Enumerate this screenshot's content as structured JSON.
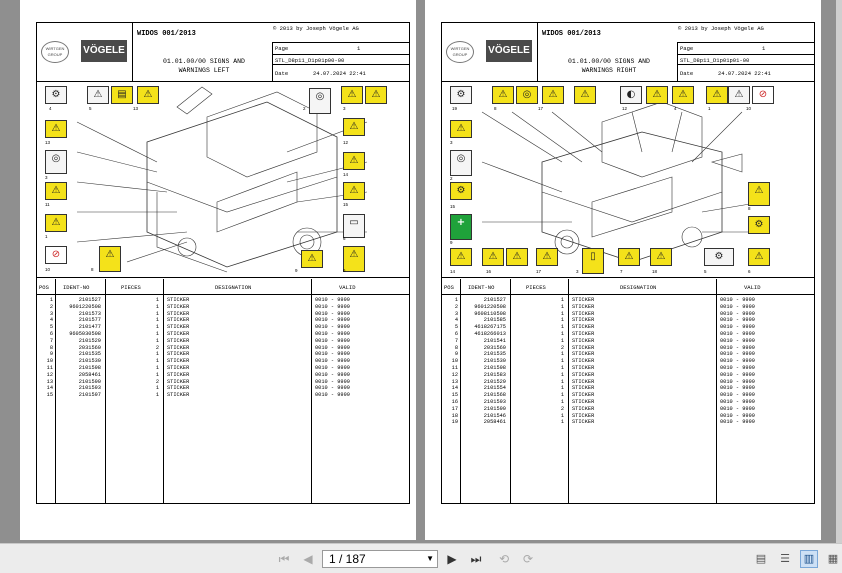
{
  "pages": [
    {
      "doc_title": "WIDOS 001/2013",
      "copyright": "© 2013 by Joseph Vögele AG",
      "logo_left": "WIRTGEN GROUP",
      "logo_right": "VÖGELE",
      "section_line1": "01.01.00/00 SIGNS AND",
      "section_line2": "WARNINGS LEFT",
      "page_label": "Page",
      "page_number": "1",
      "doc_code": "STL_D8p11_D1p01p00-00",
      "date_label": "Date",
      "date_value": "24.07.2024  22:41",
      "sign_numbers": [
        "4",
        "5",
        "13",
        "2",
        "3",
        "13",
        "12",
        "3",
        "14",
        "11",
        "15",
        "1",
        "6",
        "10",
        "8",
        "9",
        "6"
      ],
      "table": {
        "headers": [
          "POS",
          "IDENT-NO",
          "PIECES",
          "DESIGNATION",
          "VALID"
        ],
        "rows": [
          [
            "1",
            "2101527",
            "1",
            "STICKER",
            "0010 - 9999"
          ],
          [
            "2",
            "9601220508",
            "1",
            "STICKER",
            "0010 - 9999"
          ],
          [
            "3",
            "2101573",
            "1",
            "STICKER",
            "0010 - 9999"
          ],
          [
            "4",
            "2101577",
            "1",
            "STICKER",
            "0010 - 9999"
          ],
          [
            "5",
            "2101477",
            "1",
            "STICKER",
            "0010 - 9999"
          ],
          [
            "6",
            "9605030508",
            "1",
            "STICKER",
            "0010 - 9999"
          ],
          [
            "7",
            "2101529",
            "1",
            "STICKER",
            "0010 - 9999"
          ],
          [
            "8",
            "2031560",
            "2",
            "STICKER",
            "0010 - 9999"
          ],
          [
            "9",
            "2101535",
            "1",
            "STICKER",
            "0010 - 9999"
          ],
          [
            "10",
            "2101530",
            "1",
            "STICKER",
            "0010 - 9999"
          ],
          [
            "11",
            "2101598",
            "1",
            "STICKER",
            "0010 - 9999"
          ],
          [
            "12",
            "2058461",
            "1",
            "STICKER",
            "0010 - 9999"
          ],
          [
            "13",
            "2101590",
            "2",
            "STICKER",
            "0010 - 9999"
          ],
          [
            "14",
            "2101593",
            "1",
            "STICKER",
            "0010 - 9999"
          ],
          [
            "15",
            "2101597",
            "1",
            "STICKER",
            "0010 - 9999"
          ]
        ]
      }
    },
    {
      "doc_title": "WIDOS 001/2013",
      "copyright": "© 2013 by Joseph Vögele AG",
      "logo_left": "WIRTGEN GROUP",
      "logo_right": "VÖGELE",
      "section_line1": "01.01.00/00 SIGNS AND",
      "section_line2": "WARNINGS RIGHT",
      "page_label": "Page",
      "page_number": "1",
      "doc_code": "STL_D8p11_D1p01p01-00",
      "date_label": "Date",
      "date_value": "24.07.2024  22:41",
      "sign_numbers": [
        "19",
        "8",
        "17",
        "12",
        "4",
        "1",
        "10",
        "3",
        "2",
        "15",
        "8",
        "9",
        "14",
        "16",
        "17",
        "3",
        "7",
        "18",
        "5",
        "6"
      ],
      "table": {
        "headers": [
          "POS",
          "IDENT-NO",
          "PIECES",
          "DESIGNATION",
          "VALID"
        ],
        "rows": [
          [
            "1",
            "2101527",
            "1",
            "STICKER",
            "0010 - 9999"
          ],
          [
            "2",
            "9601220508",
            "1",
            "STICKER",
            "0010 - 9999"
          ],
          [
            "3",
            "9608110508",
            "1",
            "STICKER",
            "0010 - 9999"
          ],
          [
            "4",
            "2101585",
            "1",
            "STICKER",
            "0010 - 9999"
          ],
          [
            "5",
            "4618267175",
            "1",
            "STICKER",
            "0010 - 9999"
          ],
          [
            "6",
            "4618266013",
            "1",
            "STICKER",
            "0010 - 9999"
          ],
          [
            "7",
            "2101541",
            "1",
            "STICKER",
            "0010 - 9999"
          ],
          [
            "8",
            "2031560",
            "2",
            "STICKER",
            "0010 - 9999"
          ],
          [
            "9",
            "2101535",
            "1",
            "STICKER",
            "0010 - 9999"
          ],
          [
            "10",
            "2101530",
            "1",
            "STICKER",
            "0010 - 9999"
          ],
          [
            "11",
            "2101598",
            "1",
            "STICKER",
            "0010 - 9999"
          ],
          [
            "12",
            "2101583",
            "1",
            "STICKER",
            "0010 - 9999"
          ],
          [
            "13",
            "2101529",
            "1",
            "STICKER",
            "0010 - 9999"
          ],
          [
            "14",
            "2101554",
            "1",
            "STICKER",
            "0010 - 9999"
          ],
          [
            "15",
            "2101568",
            "1",
            "STICKER",
            "0010 - 9999"
          ],
          [
            "16",
            "2101593",
            "1",
            "STICKER",
            "0010 - 9999"
          ],
          [
            "17",
            "2101590",
            "2",
            "STICKER",
            "0010 - 9999"
          ],
          [
            "18",
            "2101546",
            "1",
            "STICKER",
            "0010 - 9999"
          ],
          [
            "19",
            "2058461",
            "1",
            "STICKER",
            "0010 - 9999"
          ]
        ]
      }
    }
  ],
  "toolbar": {
    "page_display": "1 / 187",
    "icons": [
      "first-page-icon",
      "previous-page-icon",
      "next-page-icon",
      "last-page-icon",
      "rotate-left-icon",
      "rotate-right-icon",
      "single-page-view-icon",
      "continuous-view-icon",
      "two-page-view-icon",
      "two-page-continuous-view-icon"
    ]
  }
}
